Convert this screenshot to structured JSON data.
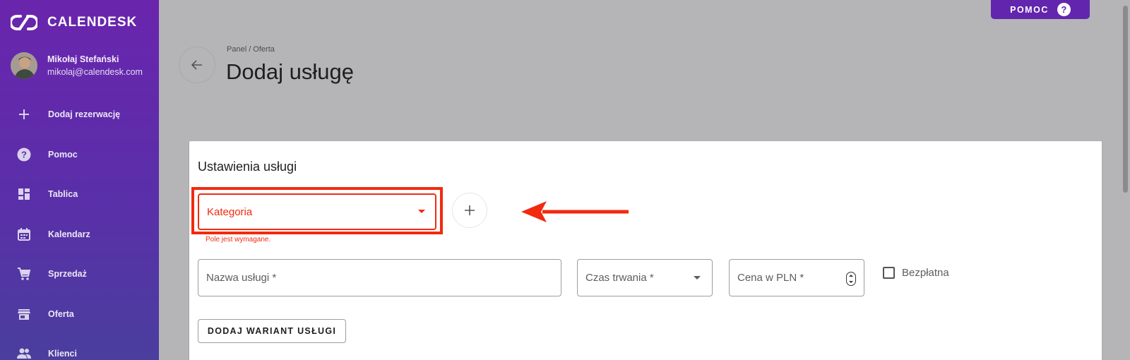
{
  "brand": {
    "name": "CALENDESK"
  },
  "user": {
    "name": "Mikołaj Stefański",
    "email": "mikolaj@calendesk.com"
  },
  "nav": {
    "items": [
      {
        "label": "Dodaj rezerwację",
        "icon": "plus-icon"
      },
      {
        "label": "Pomoc",
        "icon": "help-circle-icon"
      },
      {
        "label": "Tablica",
        "icon": "dashboard-icon"
      },
      {
        "label": "Kalendarz",
        "icon": "calendar-icon"
      },
      {
        "label": "Sprzedaż",
        "icon": "cart-icon"
      },
      {
        "label": "Oferta",
        "icon": "store-icon"
      },
      {
        "label": "Klienci",
        "icon": "users-icon"
      }
    ]
  },
  "help_button": {
    "label": "POMOC",
    "icon": "help-circle-icon"
  },
  "header": {
    "breadcrumb": "Panel / Oferta",
    "title": "Dodaj usługę"
  },
  "card": {
    "title": "Ustawienia usługi",
    "category": {
      "label": "Kategoria",
      "error": "Pole jest wymagane."
    },
    "name_field": {
      "label": "Nazwa usługi *"
    },
    "duration_field": {
      "label": "Czas trwania *"
    },
    "price_field": {
      "label": "Cena w PLN *"
    },
    "free_checkbox": {
      "label": "Bezpłatna",
      "checked": false
    },
    "variant_button": {
      "label": "DODAJ WARIANT USŁUGI"
    }
  },
  "colors": {
    "sidebar_top": "#6a25ad",
    "sidebar_bottom": "#4a3e9e",
    "accent": "#6225ad",
    "error": "#f22a0f",
    "overlay": "#b5b4b7"
  }
}
